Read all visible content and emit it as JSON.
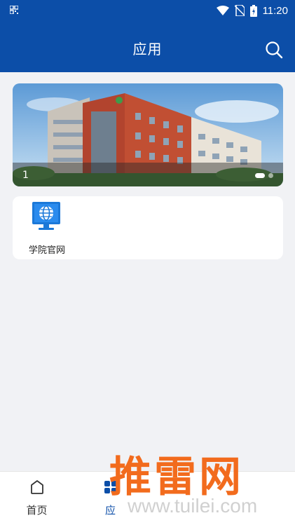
{
  "status_bar": {
    "time": "11:20",
    "icons": [
      "qr-icon",
      "wifi-icon",
      "no-sim-icon",
      "battery-charging-icon"
    ]
  },
  "header": {
    "title": "应用",
    "search_icon": "search-icon"
  },
  "banner": {
    "index": "1",
    "slide_count": 2,
    "active_slide": 1
  },
  "apps": [
    {
      "label": "学院官网",
      "icon": "monitor-globe-icon"
    }
  ],
  "bottom_nav": {
    "items": [
      {
        "label": "首页",
        "icon": "home-icon",
        "active": false
      },
      {
        "label": "应",
        "icon": "apps-icon",
        "active": true
      }
    ]
  },
  "watermark": {
    "main": "推雷网",
    "sub": "www.tuilei.com"
  },
  "colors": {
    "primary": "#0c4ea8",
    "background": "#f1f2f5",
    "watermark": "#f26b1d"
  }
}
